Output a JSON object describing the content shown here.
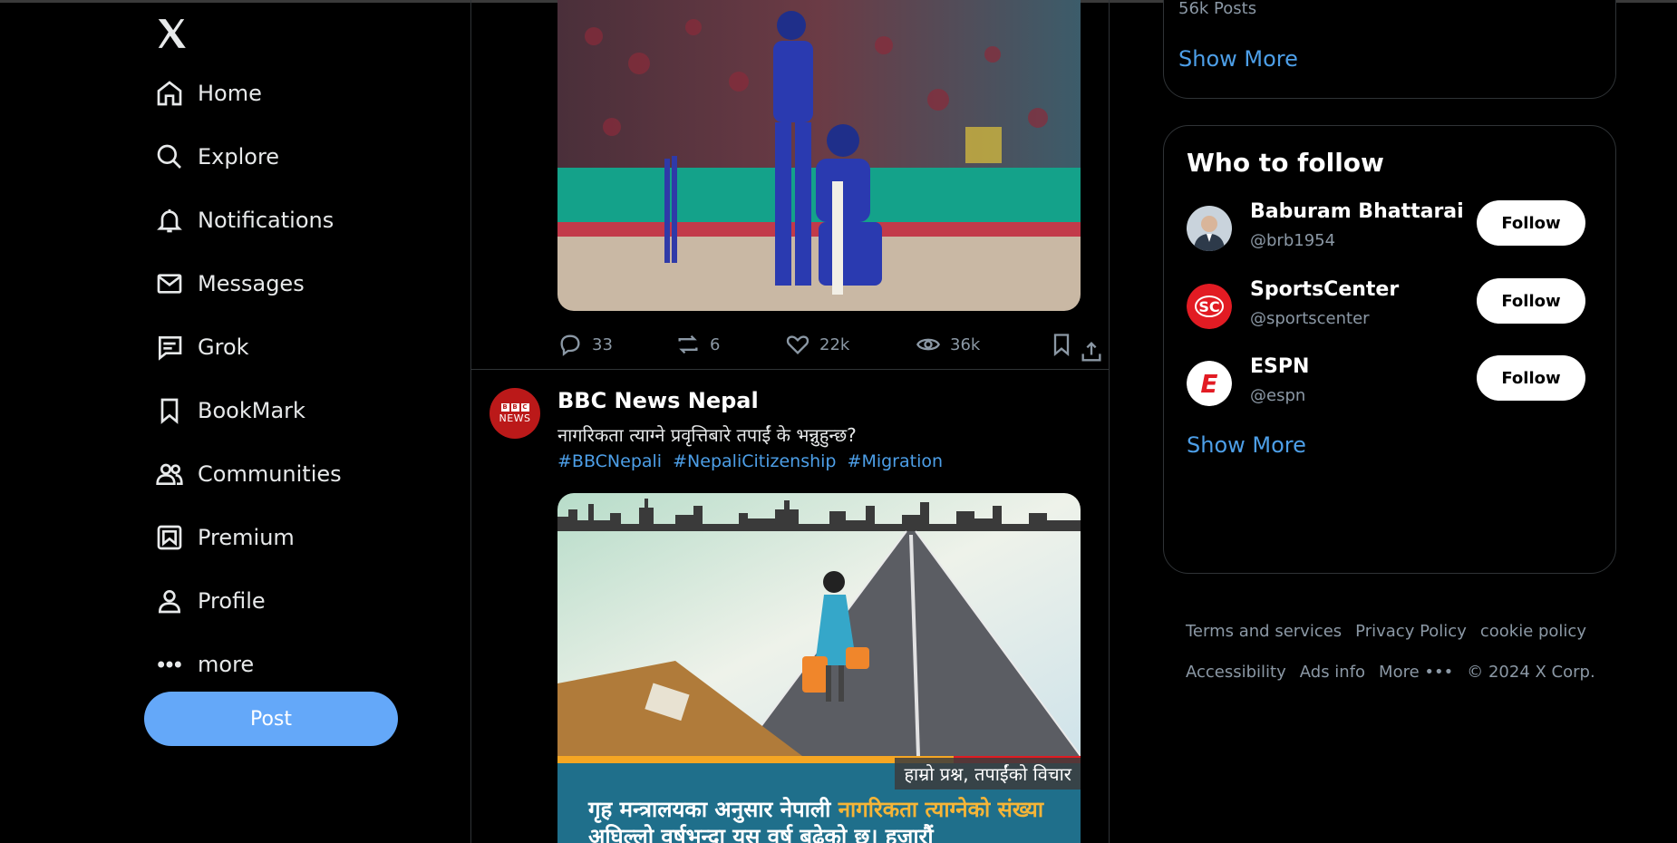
{
  "nav": {
    "items": [
      {
        "label": "Home",
        "icon": "home-icon"
      },
      {
        "label": "Explore",
        "icon": "search-icon"
      },
      {
        "label": "Notifications",
        "icon": "bell-icon"
      },
      {
        "label": "Messages",
        "icon": "envelope-icon"
      },
      {
        "label": "Grok",
        "icon": "grok-icon"
      },
      {
        "label": "BookMark",
        "icon": "bookmark-icon"
      },
      {
        "label": "Communities",
        "icon": "people-icon"
      },
      {
        "label": "Premium",
        "icon": "premium-icon"
      },
      {
        "label": "Profile",
        "icon": "person-icon"
      },
      {
        "label": "more",
        "icon": "more-icon"
      }
    ],
    "post_label": "Post"
  },
  "tweet1": {
    "actions": {
      "replies": "33",
      "reposts": "6",
      "likes": "22k",
      "views": "36k"
    }
  },
  "tweet2": {
    "author": "BBC News Nepal",
    "avatar_text": "BBC NEWS",
    "text": "नागरिकता त्याग्ने प्रवृत्तिबारे तपाईं के भन्नुहुन्छ?",
    "hashtags": [
      "#BBCNepali",
      "#NepaliCitizenship",
      "#Migration"
    ],
    "image": {
      "label": "हाम्रो प्रश्न, तपाईंको विचार",
      "text_a": "गृह मन्त्रालयका अनुसार नेपाली ",
      "text_highlight": "नागरिकता त्याग्नेको संख्या",
      "text_b": " अघिल्लो वर्षभन्दा यस वर्ष बढेको छ। हजारौं"
    }
  },
  "trends_card": {
    "posts": "56k Posts",
    "show_more": "Show More"
  },
  "who_to_follow": {
    "title": "Who to follow",
    "accounts": [
      {
        "name": "Baburam Bhattarai",
        "handle": "@brb1954",
        "button": "Follow"
      },
      {
        "name": "SportsCenter",
        "handle": "@sportscenter",
        "button": "Follow",
        "logo_text": "SC"
      },
      {
        "name": "ESPN",
        "handle": "@espn",
        "button": "Follow",
        "logo_text": "E"
      }
    ],
    "show_more": "Show More"
  },
  "footer": {
    "row1": [
      "Terms and services",
      "Privacy Policy",
      "cookie policy"
    ],
    "row2": [
      "Accessibility",
      "Ads info",
      "More •••"
    ],
    "copyright": "© 2024 X Corp."
  },
  "colors": {
    "accent": "#4d9fe8",
    "post_button": "#64a8f9",
    "bbc_red": "#bb1919",
    "espn_red": "#e21b23"
  }
}
